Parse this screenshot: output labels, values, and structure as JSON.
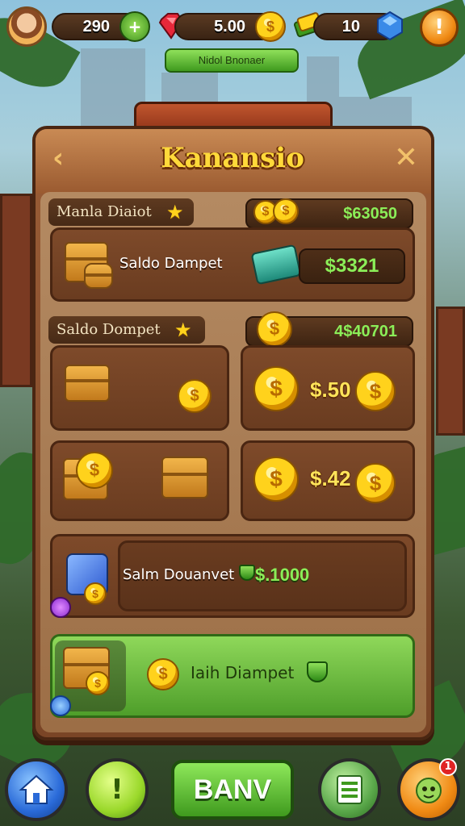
{
  "hud": {
    "resource_1": "290",
    "resource_2": "5.00",
    "resource_3": "10",
    "orange_button_glyph": "!",
    "plus_glyph": "+",
    "banner": "Nidol Bnonaer"
  },
  "panel": {
    "title": "Kanansio",
    "back_glyph": "‹",
    "close_glyph": "✕"
  },
  "section_1": {
    "label": "Manla Diaiot",
    "amount": "$63050",
    "card_text": "Saldo Dampet",
    "card_value": "$3321"
  },
  "section_2": {
    "label": "Saldo Dompet",
    "amount": "4$40701",
    "tiles": [
      {
        "price": ""
      },
      {
        "price": "$.50"
      },
      {
        "price": ""
      },
      {
        "price": "$.42"
      }
    ]
  },
  "row_blue": {
    "text": "Salm Douanvet",
    "value": "$.1000"
  },
  "row_green": {
    "text": "Iaih Diampet"
  },
  "bottom_nav": {
    "bank_label": "BANV",
    "coin_glyph": "!",
    "badge_count": "1"
  },
  "colors": {
    "accent_green": "#8bee58",
    "title_gold": "#ffd93a",
    "panel_brown": "#7a4526"
  }
}
